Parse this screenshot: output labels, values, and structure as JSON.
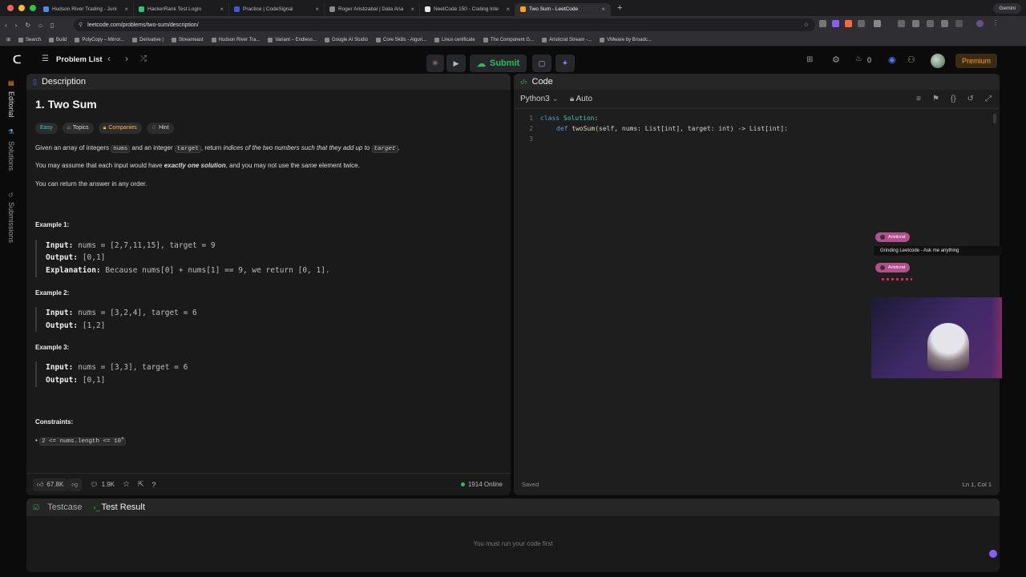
{
  "browser": {
    "tabs": [
      {
        "title": "Hudson River Trading - Juni",
        "color": "#4c8bf5"
      },
      {
        "title": "HackerRank Test Login",
        "color": "#2ec866"
      },
      {
        "title": "Practice | CodeSignal",
        "color": "#3b5bdb"
      },
      {
        "title": "Roger Aristizabal | Data Ana",
        "color": "#8a8a8a"
      },
      {
        "title": "NeetCode 150 - Coding Inte",
        "color": "#e8e8e8"
      },
      {
        "title": "Two Sum - LeetCode",
        "color": "#ffa116",
        "active": true
      }
    ],
    "gemini_label": "Gemini",
    "url": "leetcode.com/problems/two-sum/description/",
    "bookmarks": [
      "Search",
      "Build",
      "PolyCopy – Mirror...",
      "Derivative |",
      "Streameast",
      "Hudson River Tra...",
      "Variant – Endless...",
      "Google AI Studio",
      "Core Skills - Algori...",
      "Linux certificate",
      "The Component G...",
      "Aristicrat Stream -...",
      "VMware by Broadc..."
    ]
  },
  "nav": {
    "problem_list": "Problem List",
    "submit": "Submit",
    "streak": "0",
    "premium": "Premium"
  },
  "rail": {
    "editorial": "Editorial",
    "solutions": "Solutions",
    "submissions": "Submissions"
  },
  "description": {
    "tab": "Description",
    "title": "1. Two Sum",
    "chips": {
      "difficulty": "Easy",
      "topics": "Topics",
      "companies": "Companies",
      "hint": "Hint"
    },
    "p1": {
      "a": "Given an array of integers ",
      "nums": "nums",
      "b": " and an integer ",
      "target": "target",
      "c": ", return ",
      "d": "indices of the two numbers such that they add up to ",
      "target2": "target",
      "e": "."
    },
    "p2": {
      "a": "You may assume that each input would have ",
      "b": "exactly one solution",
      "c": ", and you may not use the ",
      "d": "same",
      "e": " element twice."
    },
    "p3": "You can return the answer in any order.",
    "examples": [
      {
        "head": "Example 1:",
        "input": "nums = [2,7,11,15], target = 9",
        "output": "[0,1]",
        "explanation": "Because nums[0] + nums[1] == 9, we return [0, 1]."
      },
      {
        "head": "Example 2:",
        "input": "nums = [3,2,4], target = 6",
        "output": "[1,2]"
      },
      {
        "head": "Example 3:",
        "input": "nums = [3,3], target = 6",
        "output": "[0,1]"
      }
    ],
    "labels": {
      "input": "Input:",
      "output": "Output:",
      "explanation": "Explanation:"
    },
    "constraints_head": "Constraints:",
    "constraint1": "2 <= nums.length <= 10",
    "constraint1_exp": "4",
    "footer": {
      "likes": "67.8K",
      "comments": "1.9K",
      "online": "1914 Online"
    }
  },
  "code": {
    "tab": "Code",
    "language": "Python3",
    "mode": "Auto",
    "line_numbers": [
      "1",
      "2",
      "3"
    ],
    "line1": {
      "kw": "class",
      "name": "Solution",
      "rest": ":"
    },
    "line2": {
      "kw": "def",
      "fn": "twoSum",
      "rest": "(self, nums: List[int], target: int) -> List[int]:"
    },
    "status": "Saved",
    "cursor": "Ln 1, Col 1"
  },
  "chat": {
    "user": "Aristicrat",
    "message": "Grinding Leetcode - Ask me anything"
  },
  "test": {
    "testcase": "Testcase",
    "result": "Test Result",
    "empty": "You must run your code first"
  },
  "colors": {
    "accent": "#ffa116",
    "submit": "#2cbb5d",
    "easy": "#46c6c2"
  }
}
